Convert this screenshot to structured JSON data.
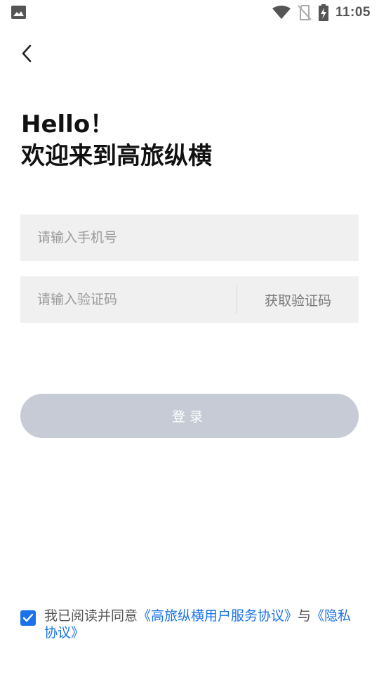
{
  "status_bar": {
    "time": "11:05",
    "left_icon": "image-notification-icon",
    "right_icons": [
      "wifi-icon",
      "no-sim-icon",
      "battery-charging-icon"
    ]
  },
  "nav": {
    "back_icon": "chevron-left-icon"
  },
  "header": {
    "greeting": "Hello！",
    "welcome": "欢迎来到高旅纵横"
  },
  "form": {
    "phone_placeholder": "请输入手机号",
    "phone_value": "",
    "code_placeholder": "请输入验证码",
    "code_value": "",
    "get_code_label": "获取验证码",
    "login_label": "登录"
  },
  "agreement": {
    "checked": true,
    "prefix": "我已阅读并同意",
    "service_link": "《高旅纵横用户服务协议》",
    "conjunction": "与",
    "privacy_link": "《隐私协议》"
  },
  "colors": {
    "accent": "#1a73e8",
    "login_disabled": "#c6cbd6",
    "input_bg": "#f0f0f0"
  }
}
